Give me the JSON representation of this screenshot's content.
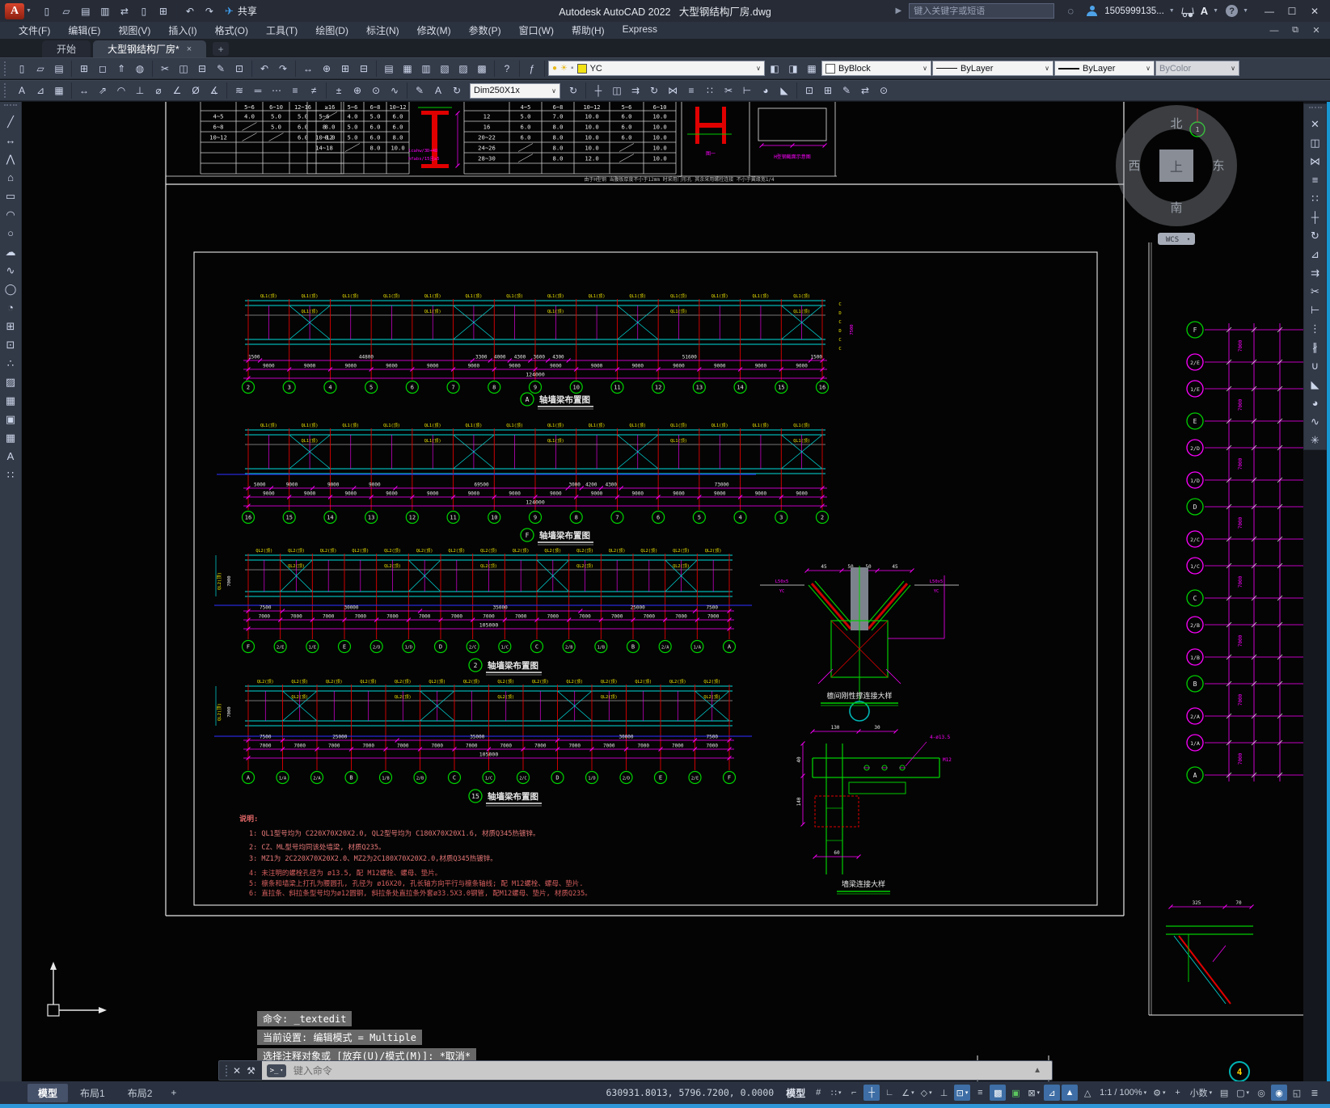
{
  "window": {
    "app_title": "Autodesk AutoCAD 2022",
    "doc_title": "大型钢结构厂房.dwg",
    "share": "共享",
    "search_placeholder": "键入关键字或短语",
    "account": "1505999135..."
  },
  "menus": [
    "文件(F)",
    "编辑(E)",
    "视图(V)",
    "插入(I)",
    "格式(O)",
    "工具(T)",
    "绘图(D)",
    "标注(N)",
    "修改(M)",
    "参数(P)",
    "窗口(W)",
    "帮助(H)",
    "Express"
  ],
  "tabs": {
    "start": "开始",
    "document": "大型钢结构厂房*",
    "close": "×",
    "new_tab": "+"
  },
  "toolbars": {
    "layer": "YC",
    "color": "ByBlock",
    "linetype": "ByLayer",
    "lineweight": "ByLayer",
    "plot_style": "ByColor",
    "dim_style": "Dim250X1x",
    "quick_access_icons": [
      "new",
      "open",
      "save",
      "save-as",
      "transfer",
      "mobile",
      "print",
      "|",
      "undo",
      "redo"
    ],
    "standard_icons": [
      "new",
      "open",
      "save",
      "|",
      "plot",
      "plot-preview",
      "publish",
      "etransmit",
      "|",
      "cut",
      "copy",
      "paste",
      "match-properties",
      "block-editor",
      "|",
      "undo",
      "redo",
      "|",
      "pan",
      "zoom-realtime",
      "zoom-window",
      "zoom-previous",
      "|",
      "properties",
      "design-center",
      "tool-palettes",
      "sheet-set-manager",
      "markup",
      "quick-calc",
      "|",
      "help",
      "|",
      "field"
    ],
    "style_icons": [
      "text-style",
      "dim-style-manager",
      "table-style"
    ],
    "dim_icons": [
      "dim-linear",
      "dim-aligned",
      "dim-arc",
      "dim-ordinate",
      "dim-radius",
      "dim-jogged",
      "dim-diameter",
      "dim-angular",
      "|",
      "dim-quick",
      "dim-baseline",
      "dim-continue",
      "dim-space",
      "dim-break",
      "|",
      "tolerance",
      "center-mark",
      "dim-inspect",
      "dim-jog-line",
      "|",
      "dim-edit",
      "dim-text-edit",
      "dim-update"
    ],
    "extra_icons": [
      "dim-update",
      "|",
      "move",
      "copy",
      "stretch",
      "rotate",
      "mirror",
      "offset",
      "array",
      "trim",
      "extend",
      "fillet",
      "chamfer",
      "|",
      "make-block",
      "insert-block",
      "edit-attribute",
      "sync-attributes",
      "set-base-point"
    ],
    "draw_icons": [
      "line",
      "construction-line",
      "polyline",
      "polygon",
      "rectangle",
      "arc",
      "circle",
      "revision-cloud",
      "spline",
      "ellipse",
      "ellipse-arc",
      "insert-block",
      "create-block",
      "point",
      "hatch",
      "gradient",
      "region",
      "table",
      "multiline-text",
      "point-style"
    ],
    "modify_icons": [
      "erase",
      "copy",
      "mirror",
      "offset",
      "array",
      "move",
      "rotate",
      "scale",
      "stretch",
      "trim",
      "extend",
      "break-at-point",
      "break",
      "join",
      "chamfer",
      "fillet",
      "blend",
      "explode"
    ]
  },
  "command": {
    "history": [
      "命令: _textedit",
      "当前设置: 编辑模式 = Multiple",
      "选择注释对象或 [放弃(U)/模式(M)]: *取消*"
    ],
    "placeholder": "键入命令"
  },
  "status": {
    "layout_tabs": [
      "模型",
      "布局1",
      "布局2"
    ],
    "new_layout": "+",
    "coords": "630931.8013, 5796.7200, 0.0000",
    "space_label": "模型",
    "icons": [
      {
        "name": "grid-mode",
        "glyph": "#"
      },
      {
        "name": "snap-mode",
        "glyph": "∷",
        "caret": true
      },
      {
        "name": "infer-constraints",
        "glyph": "⌐"
      },
      {
        "name": "dynamic-input",
        "glyph": "┼",
        "on": true
      },
      {
        "name": "ortho-mode",
        "glyph": "∟"
      },
      {
        "name": "polar-tracking",
        "glyph": "∠",
        "caret": true
      },
      {
        "name": "isometric-drafting",
        "glyph": "◇",
        "caret": true
      },
      {
        "name": "object-snap-tracking",
        "glyph": "⊥"
      },
      {
        "name": "object-snap",
        "glyph": "⊡",
        "on": true,
        "caret": true
      },
      {
        "name": "lineweight-display",
        "glyph": "≡"
      },
      {
        "name": "transparency",
        "glyph": "▩",
        "on": true
      },
      {
        "name": "selection-cycling",
        "glyph": "▣",
        "accent": "#5bc75e"
      },
      {
        "name": "3d-object-snap",
        "glyph": "⊠",
        "caret": true
      },
      {
        "name": "dynamic-ucs",
        "glyph": "⊿",
        "on": true
      },
      {
        "name": "annotation-visibility",
        "glyph": "▲",
        "on": true
      },
      {
        "name": "autoscale",
        "glyph": "△"
      },
      {
        "name": "annotation-scale",
        "label": "1:1 / 100%",
        "caret": true
      },
      {
        "name": "workspace-switching",
        "glyph": "⚙",
        "caret": true
      },
      {
        "name": "annotation-monitor",
        "glyph": "+"
      },
      {
        "name": "current-units",
        "label": "小数",
        "caret": true
      },
      {
        "name": "quick-properties",
        "glyph": "▤"
      },
      {
        "name": "lock-ui",
        "glyph": "▢",
        "caret": true
      },
      {
        "name": "isolate-objects",
        "glyph": "◎"
      },
      {
        "name": "graphics-performance",
        "glyph": "◉",
        "on": true
      },
      {
        "name": "clean-screen",
        "glyph": "◱"
      },
      {
        "name": "customization",
        "glyph": "≣"
      }
    ]
  },
  "drawing": {
    "compass": {
      "north": "北",
      "south": "南",
      "east": "东",
      "west": "西",
      "center": "上",
      "view_bubble": "1"
    },
    "wcs": "WCS",
    "tables": [
      {
        "headers": [
          "",
          "5~6",
          "6~10",
          "12~16",
          "≥16"
        ],
        "rows": [
          [
            "4~5",
            "4.0",
            "5.0",
            "5.0",
            "/"
          ],
          [
            "6~8",
            "/",
            "5.0",
            "6.0",
            "8.0"
          ],
          [
            "10~12",
            "/",
            "/",
            "6.0",
            "8.0"
          ],
          [
            "",
            "",
            "",
            "",
            ""
          ],
          [
            "",
            "",
            "",
            "",
            ""
          ],
          [
            "",
            "",
            "",
            "",
            ""
          ]
        ]
      },
      {
        "headers": [
          "",
          "5~6",
          "6~8",
          "10~12"
        ],
        "rows": [
          [
            "5~6",
            "4.0",
            "5.0",
            "6.0"
          ],
          [
            "8",
            "5.0",
            "6.0",
            "6.0"
          ],
          [
            "10~12",
            "5.0",
            "6.0",
            "8.0"
          ],
          [
            "14~18",
            "/",
            "8.0",
            "10.0"
          ],
          [
            "",
            "",
            "",
            ""
          ],
          [
            "",
            "",
            "",
            ""
          ]
        ]
      },
      {
        "headers": [
          "",
          "4~5",
          "6~8",
          "10~12",
          "5~6",
          "6~10"
        ],
        "rows": [
          [
            "12",
            "5.0",
            "7.0",
            "10.0",
            "6.0",
            "10.0"
          ],
          [
            "16",
            "6.0",
            "8.0",
            "10.0",
            "6.0",
            "10.0"
          ],
          [
            "20~22",
            "6.0",
            "8.0",
            "10.0",
            "6.0",
            "10.0"
          ],
          [
            "24~26",
            "/",
            "8.0",
            "10.0",
            "/",
            "10.0"
          ],
          [
            "28~30",
            "/",
            "8.0",
            "12.0",
            "/",
            "10.0"
          ],
          [
            "",
            "",
            "",
            "",
            "",
            ""
          ]
        ]
      }
    ],
    "beam_notes": [
      "lc≥hw/3D+4D",
      "hf≥bs/15且≥5"
    ],
    "gray_note": "由于H型钢 当腹板厚度不小于12mm 时采用门形孔 其余采用螺栓连接 不小于翼缘宽1/4",
    "top_box_labels": [
      "图一",
      "H型钢截面示意图"
    ],
    "strips": [
      {
        "bubble": "A",
        "title": "轴墙梁布置图",
        "purlin": "QL1(顶)",
        "grids": [
          "2",
          "3",
          "4",
          "5",
          "6",
          "7",
          "8",
          "9",
          "10",
          "11",
          "12",
          "13",
          "14",
          "15",
          "16"
        ],
        "dims": [
          "1500",
          "44800",
          "3300",
          "4000",
          "4300",
          "3600",
          "4300",
          "51600",
          "1500"
        ],
        "bay_dim": "9000",
        "total": "124000"
      },
      {
        "bubble": "F",
        "title": "轴墙梁布置图",
        "purlin": "QL1(顶)",
        "grids": [
          "16",
          "15",
          "14",
          "13",
          "12",
          "11",
          "10",
          "9",
          "8",
          "7",
          "6",
          "5",
          "4",
          "3",
          "2"
        ],
        "dims": [
          "5000",
          "9000",
          "9000",
          "9000",
          "69500",
          "3000",
          "4200",
          "4300",
          "73000"
        ],
        "bay_dim": "9000",
        "total": "124000"
      },
      {
        "bubble": "2",
        "title": "轴墙梁布置图",
        "purlin": "QL2(顶)",
        "grids": [
          "F",
          "2/E",
          "1/E",
          "E",
          "2/D",
          "1/D",
          "D",
          "2/C",
          "1/C",
          "C",
          "2/B",
          "1/B",
          "B",
          "2/A",
          "1/A",
          "A"
        ],
        "dims": [
          "7500",
          "30000",
          "35000",
          "25000",
          "7500"
        ],
        "bay_dim": "7000",
        "total": "105000"
      },
      {
        "bubble": "15",
        "title": "轴墙梁布置图",
        "purlin": "QL2(顶)",
        "grids": [
          "A",
          "1/A",
          "2/A",
          "B",
          "1/B",
          "2/B",
          "C",
          "1/C",
          "2/C",
          "D",
          "1/D",
          "2/D",
          "E",
          "2/E",
          "F"
        ],
        "dims": [
          "7500",
          "25000",
          "35000",
          "30000",
          "7500"
        ],
        "bay_dim": "7000",
        "total": "105000"
      }
    ],
    "side_labels": [
      "C",
      "D",
      "C",
      "D",
      "C",
      "C"
    ],
    "side_dim": "7500",
    "details": [
      {
        "title": "檩间刚性撑连接大样",
        "labels": [
          "45",
          "50",
          "50",
          "45",
          "L50x5",
          "YC",
          "L50x5",
          "YC"
        ]
      },
      {
        "title": "墙梁连接大样",
        "labels": [
          "130",
          "30",
          "40",
          "140",
          "4-ø13.5",
          "M12",
          "60"
        ]
      }
    ],
    "notes": {
      "heading": "说明:",
      "lines": [
        "1: QL1型号均为  C220X70X20X2.0, QL2型号均为  C180X70X20X1.6, 材质Q345热镀锌。",
        "2: CZ、ML型号均同该处墙梁, 材质Q235。",
        "3: MZ1为  2C220X70X20X2.0、MZ2为2C180X70X20X2.0,材质Q345热镀锌。",
        "4: 未注明的螺栓孔径为  ø13.5, 配  M12螺栓、螺母、垫片。",
        "5: 檩条和墙梁上打孔为腰圆孔, 孔径为  ø16X20, 孔长轴方向平行与檩条轴线; 配  M12螺栓、螺母、垫片.",
        "6: 直拉条、斜拉条型号均为ø12圆钢, 斜拉条处直拉条外套ø33.5X3.0钢管, 配M12螺母、垫片, 材质Q235。"
      ]
    },
    "right_grid": {
      "grids": [
        "F",
        "2/E",
        "1/E",
        "E",
        "2/D",
        "1/D",
        "D",
        "2/C",
        "1/C",
        "C",
        "2/B",
        "1/B",
        "B",
        "2/A",
        "1/A",
        "A"
      ],
      "dim": "7000",
      "corner_dims": [
        "325",
        "70"
      ],
      "view_bubble": "4"
    }
  }
}
